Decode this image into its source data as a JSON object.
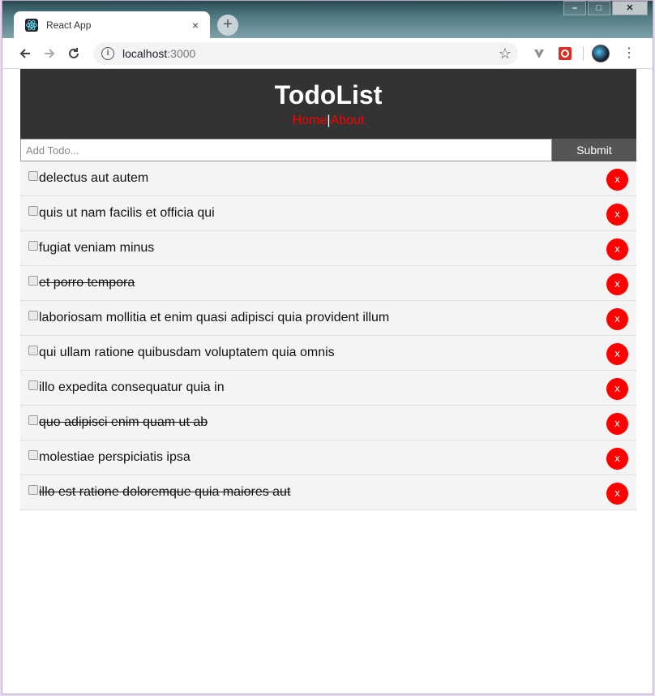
{
  "browser": {
    "tab_title": "React App",
    "tab_close": "×",
    "new_tab": "+",
    "url_host": "localhost",
    "url_port": ":3000",
    "window_controls": {
      "minimize": "–",
      "maximize": "□",
      "close": "✕"
    },
    "star": "☆",
    "menu": "⋮"
  },
  "app": {
    "title": "TodoList",
    "nav": {
      "home": "Home",
      "separator": "|",
      "about": "About"
    },
    "form": {
      "placeholder": "Add Todo...",
      "submit_label": "Submit"
    },
    "delete_label": "x",
    "todos": [
      {
        "title": "delectus aut autem",
        "completed": false
      },
      {
        "title": "quis ut nam facilis et officia qui",
        "completed": false
      },
      {
        "title": "fugiat veniam minus",
        "completed": false
      },
      {
        "title": "et porro tempora",
        "completed": true
      },
      {
        "title": "laboriosam mollitia et enim quasi adipisci quia provident illum",
        "completed": false
      },
      {
        "title": "qui ullam ratione quibusdam voluptatem quia omnis",
        "completed": false
      },
      {
        "title": "illo expedita consequatur quia in",
        "completed": false
      },
      {
        "title": "quo adipisci enim quam ut ab",
        "completed": true
      },
      {
        "title": "molestiae perspiciatis ipsa",
        "completed": false
      },
      {
        "title": "illo est ratione doloremque quia maiores aut",
        "completed": true
      }
    ]
  },
  "colors": {
    "header_bg": "#333333",
    "accent_red": "#ff0000",
    "submit_bg": "#555555",
    "item_bg": "#f4f4f4"
  },
  "icons": [
    "react-logo-icon",
    "back-arrow-icon",
    "forward-arrow-icon",
    "reload-icon",
    "info-icon",
    "star-icon",
    "extension-v-icon",
    "extension-red-icon",
    "profile-avatar-icon",
    "menu-dots-icon"
  ]
}
